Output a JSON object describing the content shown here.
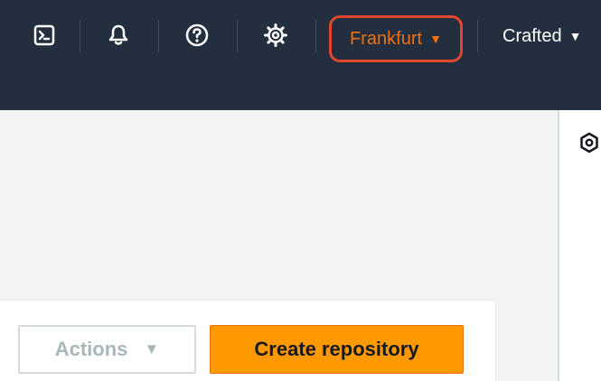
{
  "topnav": {
    "icons": {
      "cloudshell": "terminal-icon",
      "notifications": "bell-icon",
      "support": "help-icon",
      "settings": "gear-icon"
    },
    "region_label": "Frankfurt",
    "account_label": "Crafted",
    "highlight_color": "#e2462f",
    "accent_color": "#ec7211"
  },
  "main": {
    "actions_label": "Actions",
    "create_label": "Create repository",
    "primary_color": "#ff9900"
  },
  "right_rail": {
    "icon": "info-panel-icon"
  }
}
